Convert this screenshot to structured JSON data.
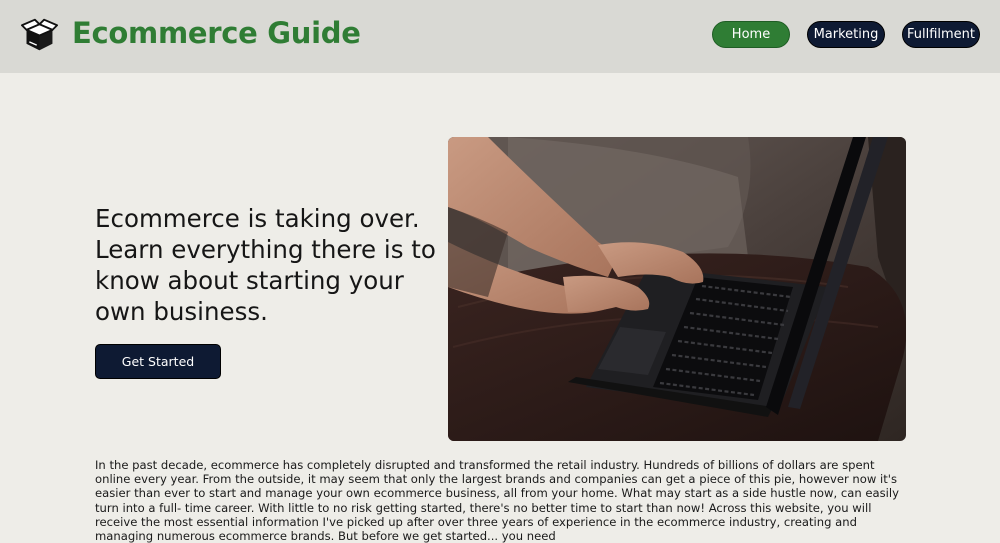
{
  "header": {
    "brand": "Ecommerce Guide",
    "logo_icon": "open-box-icon",
    "nav": [
      {
        "label": "Home",
        "active": true
      },
      {
        "label": "Marketing",
        "active": false
      },
      {
        "label": "Fullfilment",
        "active": false
      }
    ]
  },
  "hero": {
    "headline": "Ecommerce is taking over. Learn everything there is to know about starting your own business.",
    "cta_label": "Get Started",
    "image": "hands-typing-on-laptop-photo"
  },
  "intro": {
    "paragraph": "In the past decade, ecommerce has completely disrupted and transformed the retail industry. Hundreds of billions of dollars are spent online every year. From the outside, it may seem that only the largest brands and companies can get a piece of this pie, however now it's easier than ever to start and manage your own ecommerce business, all from your home. What may start as a side hustle now, can easily turn into a full- time career. With little to no risk getting started, there's no better time to start than now! Across this website, you will receive the most essential information I've picked up after over three years of experience in the ecommerce industry, creating and managing numerous ecommerce brands. But before we get started... you need"
  },
  "colors": {
    "header_bg": "#d9d9d4",
    "page_bg": "#eeede8",
    "brand_green": "#2f7d34",
    "navy": "#0e1a33"
  }
}
